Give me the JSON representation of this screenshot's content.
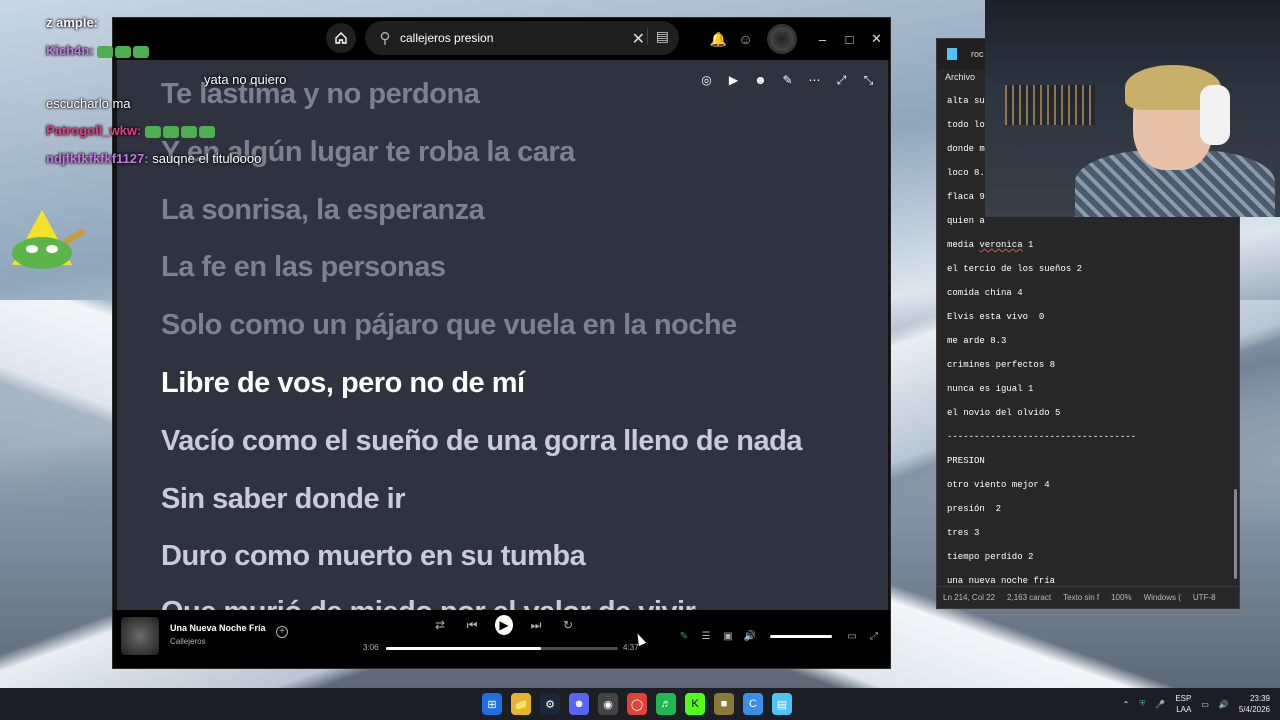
{
  "chat": {
    "messages": [
      {
        "user": "z ample:",
        "text": "",
        "color": "#ffffff"
      },
      {
        "user": "Kich4n:",
        "text": "",
        "color": "#c07be0"
      },
      {
        "user": "",
        "text": "yata no quiero",
        "color": "#ffffff"
      },
      {
        "user": "",
        "text": "escucharlo ma",
        "color": "#ffffff"
      },
      {
        "user": "Patrogoll_wkw:",
        "text": "",
        "color": "#e0407b"
      },
      {
        "user": "ndjfkfkfkfkf1127:",
        "text": "sauqne el tituloooo",
        "color": "#c07be0"
      }
    ]
  },
  "spotify": {
    "search_value": "callejeros presion",
    "lyrics": [
      {
        "text": "Te lastima y no perdona",
        "state": "past"
      },
      {
        "text": "Y en algún lugar te roba la cara",
        "state": "past"
      },
      {
        "text": "La sonrisa, la esperanza",
        "state": "past"
      },
      {
        "text": "La fe en las personas",
        "state": "past"
      },
      {
        "text": "Solo como un pájaro que vuela en la noche",
        "state": "past"
      },
      {
        "text": "Libre de vos, pero no de mí",
        "state": "current"
      },
      {
        "text": "Vacío como el sueño de una gorra lleno de nada",
        "state": "future"
      },
      {
        "text": "Sin saber donde ir",
        "state": "future"
      },
      {
        "text": "Duro como muerto en su tumba",
        "state": "future"
      },
      {
        "text": "Que murió de miedo por el valor de vivir",
        "state": "future"
      }
    ],
    "player": {
      "song": "Una Nueva Noche Fría",
      "artist": "Callejeros",
      "elapsed": "3:06",
      "duration": "4:37",
      "progress": 0.67
    }
  },
  "notepad": {
    "tab": "roc",
    "menu": "Archivo",
    "lines": [
      {
        "text": "alta su"
      },
      {
        "text": "todo lo"
      },
      {
        "text": "donde m"
      },
      {
        "text": "loco 8."
      },
      {
        "text": "flaca 9"
      },
      {
        "text": "quien a"
      },
      {
        "text": "media veronica 1"
      },
      {
        "text": "el tercio de los sueños 2"
      },
      {
        "text": "comida china 4"
      },
      {
        "text": "Elvis esta vivo  0"
      },
      {
        "text": "me arde 8.3"
      },
      {
        "text": "crimines perfectos 8"
      },
      {
        "text": "nunca es igual 1"
      },
      {
        "text": "el novio del olvido 5"
      },
      {
        "text": "-----------------------------------"
      },
      {
        "text": "PRESION"
      },
      {
        "text": "otro viento mejor 4"
      },
      {
        "text": "presión  2"
      },
      {
        "text": "tres 3"
      },
      {
        "text": "tiempo perdido 2"
      },
      {
        "text": "una nueva noche fría"
      }
    ],
    "status": {
      "position": "Ln 214, Col 22",
      "chars": "2,163 caract",
      "type": "Texto sin f",
      "zoom": "100%",
      "eol": "Windows (",
      "encoding": "UTF-8"
    }
  },
  "taskbar": {
    "lang": "ESP",
    "lang2": "LAA",
    "time": "23:39",
    "date": "5/4/2026"
  }
}
